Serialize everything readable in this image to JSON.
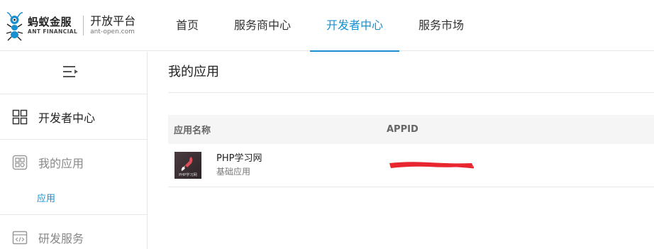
{
  "header": {
    "logo_cn": "蚂蚁金服",
    "logo_en": "ANT FINANCIAL",
    "platform_cn": "开放平台",
    "platform_en": "ant-open.com"
  },
  "nav": {
    "items": [
      {
        "label": "首页"
      },
      {
        "label": "服务商中心"
      },
      {
        "label": "开发者中心",
        "active": true
      },
      {
        "label": "服务市场"
      }
    ],
    "accent": "#1890cf"
  },
  "sidebar": {
    "items": [
      {
        "label": "开发者中心",
        "icon": "grid-icon"
      },
      {
        "label": "我的应用",
        "icon": "apps-icon"
      },
      {
        "label": "应用",
        "sub": true
      },
      {
        "label": "研发服务",
        "icon": "code-window-icon"
      }
    ]
  },
  "main": {
    "title": "我的应用",
    "table": {
      "headers": [
        "应用名称",
        "APPID"
      ],
      "rows": [
        {
          "name": "PHP学习网",
          "type": "基础应用",
          "icon_text": "PHP学习网",
          "appid_redacted": true
        }
      ]
    }
  },
  "colors": {
    "redaction": "#e8262f"
  }
}
